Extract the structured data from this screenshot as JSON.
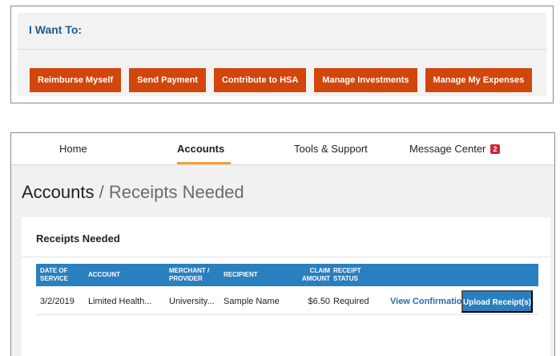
{
  "want_to": {
    "title": "I Want To:",
    "buttons": [
      "Reimburse Myself",
      "Send Payment",
      "Contribute to HSA",
      "Manage Investments",
      "Manage My Expenses"
    ]
  },
  "nav": {
    "items": [
      "Home",
      "Accounts",
      "Tools & Support",
      "Message Center"
    ],
    "active": "Accounts",
    "message_count": "2"
  },
  "breadcrumb": {
    "parent": "Accounts",
    "separator": "/",
    "current": "Receipts Needed"
  },
  "receipts": {
    "title": "Receipts Needed",
    "columns": [
      "Date of Service",
      "Account",
      "Merchant / Provider",
      "Recipient",
      "Claim Amount",
      "Receipt Status"
    ],
    "rows": [
      {
        "date": "3/2/2019",
        "account": "Limited Health...",
        "merchant": "University...",
        "recipient": "Sample Name",
        "amount": "$6.50",
        "status": "Required",
        "view_link": "View Confirmation",
        "upload_label": "Upload Receipt(s)"
      }
    ]
  },
  "colors": {
    "action_orange": "#d2450b",
    "table_blue": "#2a7fbf",
    "title_blue": "#1f5a8a",
    "tab_underline": "#f0a23c",
    "badge_red": "#d0243a"
  }
}
